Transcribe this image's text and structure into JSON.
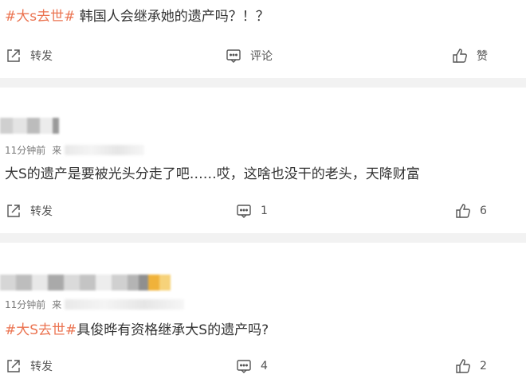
{
  "post": {
    "hashtag": "#大s去世#",
    "text": "韩国人会继承她的遗产吗？！？",
    "actions": {
      "repost": "转发",
      "comment": "评论",
      "like": "赞"
    }
  },
  "comments": [
    {
      "time": "11分钟前",
      "source_prefix": "来",
      "text": "大S的遗产是要被光头分走了吧……哎，这啥也没干的老头，天降财富",
      "actions": {
        "repost": "转发",
        "comment_count": "1",
        "like_count": "6"
      }
    },
    {
      "time": "11分钟前",
      "source_prefix": "来",
      "hashtag": "#大S去世#",
      "text": "具俊晔有资格继承大S的遗产吗?",
      "actions": {
        "repost": "转发",
        "comment_count": "4",
        "like_count": "2"
      }
    }
  ],
  "icons": [
    "repost-icon",
    "comment-icon",
    "like-icon"
  ],
  "colors": {
    "hashtag": "#eb7350",
    "separator": "#f2f2f2",
    "icon": "#555555"
  }
}
